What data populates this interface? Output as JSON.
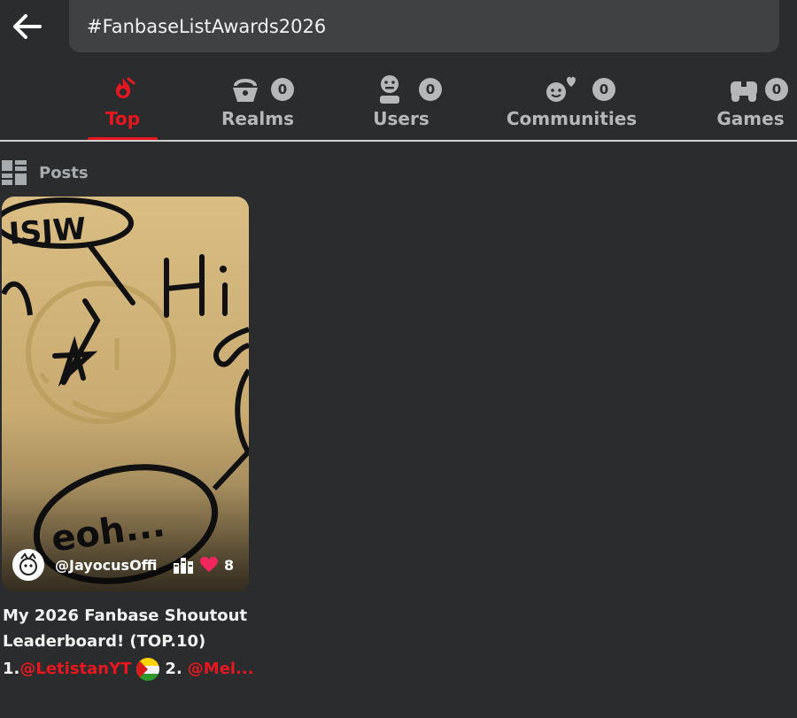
{
  "header": {
    "back_icon": "arrow-left-icon",
    "search_value": "#FanbaseListAwards2026"
  },
  "tabs": [
    {
      "label": "Top",
      "icon": "fire-icon",
      "count": null,
      "active": true
    },
    {
      "label": "Realms",
      "icon": "realm-icon",
      "count": "0"
    },
    {
      "label": "Users",
      "icon": "user-icon",
      "count": "0"
    },
    {
      "label": "Communities",
      "icon": "community-icon",
      "count": "0"
    },
    {
      "label": "Games",
      "icon": "gamepad-icon",
      "count": "0"
    }
  ],
  "colors": {
    "accent": "#e8171f",
    "background": "#2a2c2d",
    "muted": "#b5b7b9"
  },
  "posts_section": {
    "title": "Posts",
    "icon": "grid-icon"
  },
  "post": {
    "author": "@JayocusOffi",
    "likes": "8",
    "title": "My 2026 Fanbase Shoutout Leaderboard! (TOP.10)",
    "mention_prefix_1": "1.",
    "mention_1": "@LetistanYT",
    "mention_prefix_2": "2.",
    "mention_2": "@Mel..."
  }
}
